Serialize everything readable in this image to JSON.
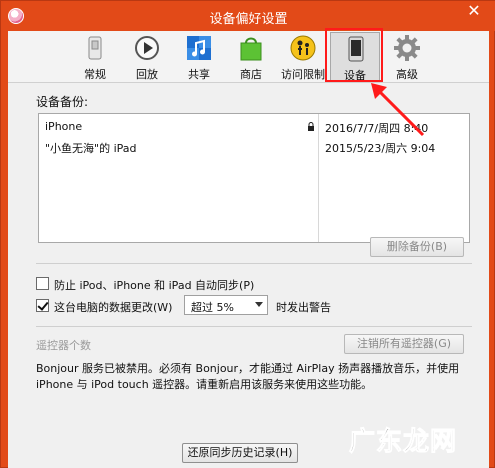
{
  "window": {
    "title": "设备偏好设置",
    "close_glyph": "✕"
  },
  "tabs": [
    {
      "id": "general",
      "label": "常规",
      "icon": "switch-icon"
    },
    {
      "id": "playback",
      "label": "回放",
      "icon": "play-icon"
    },
    {
      "id": "sharing",
      "label": "共享",
      "icon": "music-share-icon"
    },
    {
      "id": "store",
      "label": "商店",
      "icon": "shopping-bag-icon"
    },
    {
      "id": "parental",
      "label": "访问限制",
      "icon": "parental-icon"
    },
    {
      "id": "devices",
      "label": "设备",
      "icon": "phone-icon",
      "selected": true
    },
    {
      "id": "advanced",
      "label": "高级",
      "icon": "gear-icon"
    }
  ],
  "backups": {
    "label": "设备备份:",
    "items": [
      {
        "name": "iPhone",
        "locked": true,
        "date": "2016/7/7/周四 8:40"
      },
      {
        "name": "\"小鱼无海\"的 iPad",
        "locked": false,
        "date": "2015/5/23/周六 9:04"
      }
    ],
    "delete_button": "删除备份(B)"
  },
  "options": {
    "prevent_sync": {
      "label": "防止 iPod、iPhone 和 iPad 自动同步(P)",
      "checked": false
    },
    "data_warning": {
      "label": "这台电脑的数据更改(W)",
      "checked": true,
      "select_value": "超过 5%",
      "suffix": "时发出警告"
    }
  },
  "remotes": {
    "label": "遥控器个数",
    "forget_button": "注销所有遥控器(G)",
    "info": "Bonjour 服务已被禁用。必须有 Bonjour，才能通过 AirPlay 扬声器播放音乐，并使用 iPhone 与 iPod touch 遥控器。请重新启用该服务来使用这些功能。"
  },
  "reset_button": "还原同步历史记录(H)",
  "watermark": "广东龙网",
  "colors": {
    "titlebar": "#e24a18",
    "highlight": "#ff1a1a"
  }
}
